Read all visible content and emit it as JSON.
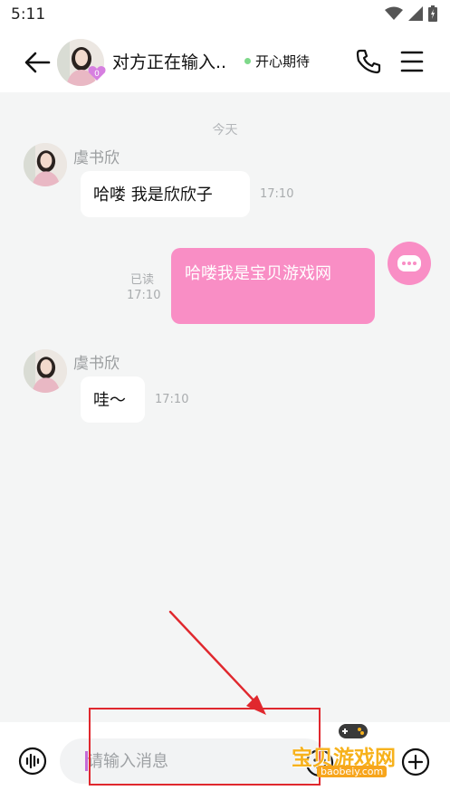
{
  "status_bar": {
    "time": "5:11",
    "icons": [
      "wifi-icon",
      "signal-icon",
      "battery-icon"
    ]
  },
  "header": {
    "title": "对方正在输入..",
    "status": "开心期待",
    "avatar_badge": "0",
    "icons": [
      "back-arrow-icon",
      "phone-icon",
      "menu-icon"
    ]
  },
  "chat": {
    "date_divider": "今天",
    "messages": [
      {
        "direction": "incoming",
        "sender": "虞书欣",
        "text": "哈喽 我是欣欣子",
        "time": "17:10"
      },
      {
        "direction": "outgoing",
        "text": "哈喽我是宝贝游戏网",
        "time": "17:10",
        "read_status": "已读"
      },
      {
        "direction": "incoming",
        "sender": "虞书欣",
        "text": "哇～",
        "time": "17:10"
      }
    ]
  },
  "input_bar": {
    "placeholder": "请输入消息",
    "icons": [
      "voice-icon",
      "emoji-icon",
      "plus-icon"
    ]
  },
  "watermark": {
    "text": "宝贝游戏网",
    "url": "baobeiy.com"
  },
  "colors": {
    "outgoing_bubble": "#f98ec5",
    "online_dot": "#7ed88a",
    "annotation": "#e0282e",
    "watermark": "#f7b21c"
  }
}
